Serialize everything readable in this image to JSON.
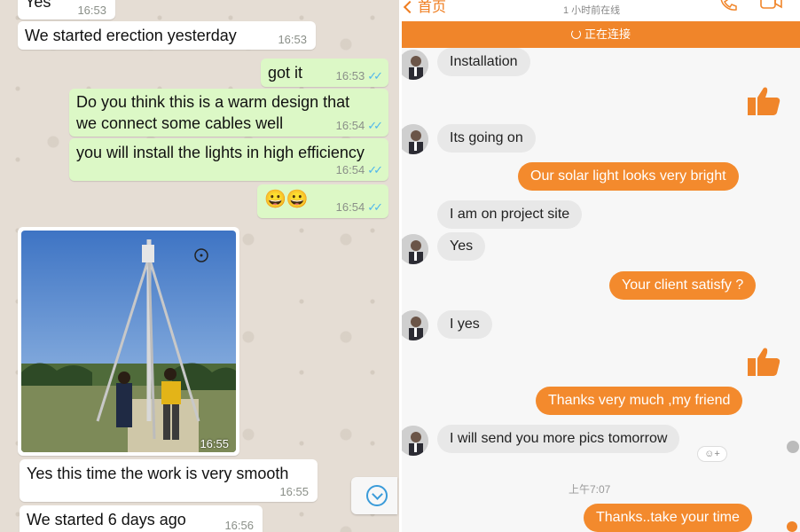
{
  "whatsapp": {
    "messages": [
      {
        "text": "Yes",
        "time": "16:53"
      },
      {
        "text": "We started erection yesterday",
        "time": "16:53"
      },
      {
        "text": "got it",
        "time": "16:53"
      },
      {
        "line1": "Do you think this is a warm design that",
        "line2": "we connect some cables well",
        "time": "16:54"
      },
      {
        "text": "you will install the lights in high efficiency",
        "time": "16:54"
      },
      {
        "text": "😀😀",
        "time": "16:54"
      },
      {
        "text": "Yes this time the work is very smooth",
        "time": "16:55"
      },
      {
        "text": "We started 6 days ago",
        "time": "16:56"
      }
    ],
    "photo_time": "16:55",
    "read_ticks": "✓✓",
    "accent": "#4fb6ec"
  },
  "chat": {
    "back_label": "首页",
    "status": "1 小时前在线",
    "banner": "正在连接",
    "accent": "#f0852a",
    "messages": [
      {
        "text": "Installation"
      },
      {
        "text": "Its going on"
      },
      {
        "text": "Our solar light looks very bright"
      },
      {
        "text": "I am on project site"
      },
      {
        "text": "Yes"
      },
      {
        "text": "Your client satisfy ?"
      },
      {
        "text": "I yes"
      },
      {
        "text": "Thanks very much ,my friend"
      },
      {
        "text": "I will send you more pics tomorrow"
      },
      {
        "text": "Thanks..take your time"
      }
    ],
    "reaction": "☺+",
    "time_separator": "上午7:07"
  }
}
